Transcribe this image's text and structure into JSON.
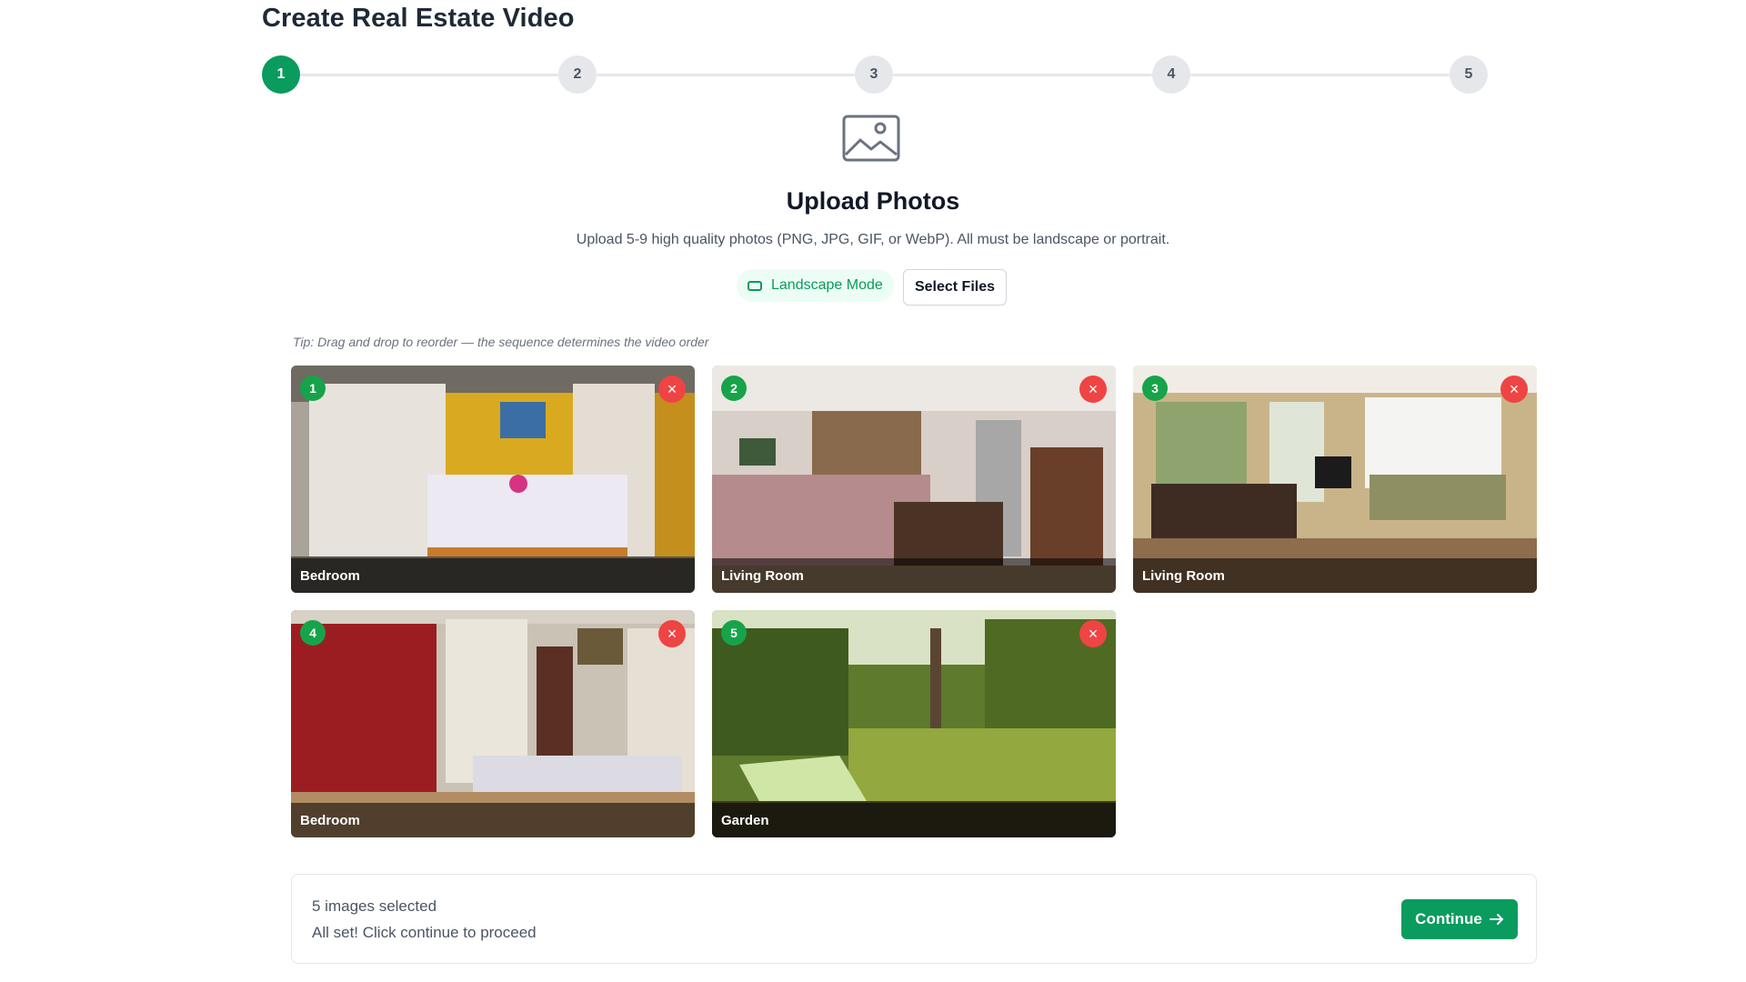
{
  "page": {
    "title": "Create Real Estate Video"
  },
  "stepper": {
    "steps": [
      "1",
      "2",
      "3",
      "4",
      "5"
    ],
    "active_step": 1
  },
  "upload": {
    "title": "Upload Photos",
    "description": "Upload 5-9 high quality photos (PNG, JPG, GIF, or WebP). All must be landscape or portrait.",
    "mode_label": "Landscape Mode",
    "select_files_label": "Select Files"
  },
  "tip": "Tip: Drag and drop to reorder — the sequence determines the video order",
  "photos": [
    {
      "index": "1",
      "caption": "Bedroom",
      "remove": "×"
    },
    {
      "index": "2",
      "caption": "Living Room",
      "remove": "×"
    },
    {
      "index": "3",
      "caption": "Living Room",
      "remove": "×"
    },
    {
      "index": "4",
      "caption": "Bedroom",
      "remove": "×"
    },
    {
      "index": "5",
      "caption": "Garden",
      "remove": "×"
    }
  ],
  "footer": {
    "count_text": "5 images selected",
    "status_text": "All set! Click continue to proceed",
    "continue_label": "Continue"
  },
  "colors": {
    "accent": "#0a9b5e",
    "remove": "#ef4444",
    "inactive_step": "#e5e7eb"
  }
}
